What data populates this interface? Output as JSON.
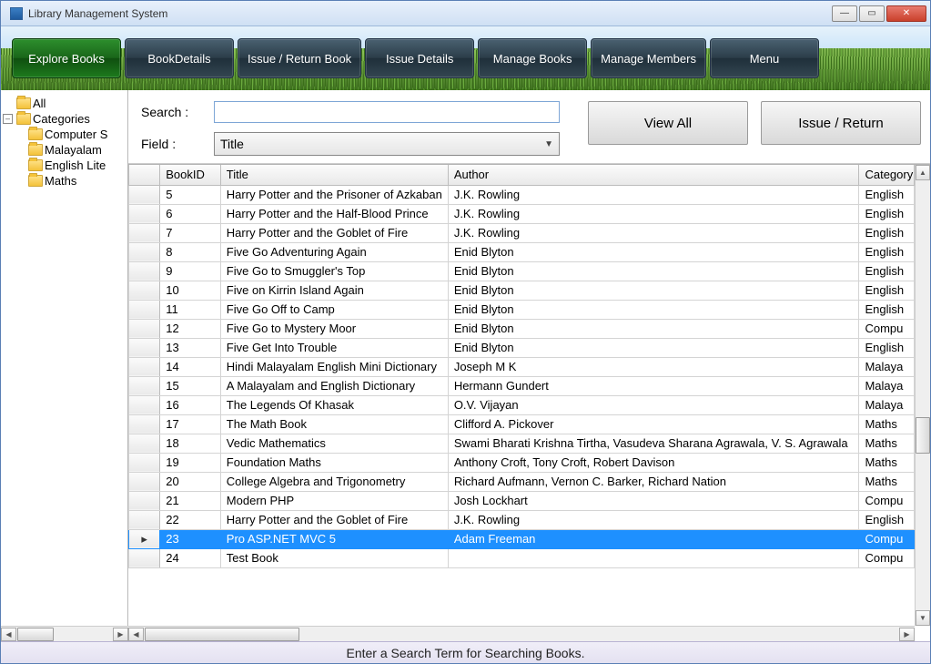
{
  "window": {
    "title": "Library Management System"
  },
  "nav": [
    {
      "label": "Explore Books",
      "active": true
    },
    {
      "label": "BookDetails"
    },
    {
      "label": "Issue / Return Book"
    },
    {
      "label": "Issue Details"
    },
    {
      "label": "Manage Books"
    },
    {
      "label": "Manage Members"
    },
    {
      "label": "Menu"
    }
  ],
  "tree": {
    "all": "All",
    "categories": "Categories",
    "children": [
      "Computer S",
      "Malayalam",
      "English Lite",
      "Maths"
    ]
  },
  "search": {
    "search_label": "Search :",
    "field_label": "Field :",
    "field_value": "Title",
    "view_all": "View All",
    "issue_return": "Issue / Return"
  },
  "grid": {
    "columns": [
      "BookID",
      "Title",
      "Author",
      "Category"
    ],
    "selected_index": 18,
    "rows": [
      {
        "id": "5",
        "title": "Harry Potter and the Prisoner of Azkaban",
        "author": "J.K. Rowling",
        "cat": "English"
      },
      {
        "id": "6",
        "title": "Harry Potter and the Half-Blood Prince",
        "author": "J.K. Rowling",
        "cat": "English"
      },
      {
        "id": "7",
        "title": "Harry Potter and the Goblet of Fire",
        "author": "J.K. Rowling",
        "cat": "English"
      },
      {
        "id": "8",
        "title": "Five Go Adventuring Again",
        "author": "Enid Blyton",
        "cat": "English"
      },
      {
        "id": "9",
        "title": "Five Go to Smuggler's Top",
        "author": "Enid Blyton",
        "cat": "English"
      },
      {
        "id": "10",
        "title": "Five on Kirrin Island Again",
        "author": "Enid Blyton",
        "cat": "English"
      },
      {
        "id": "11",
        "title": "Five Go Off to Camp",
        "author": "Enid Blyton",
        "cat": "English"
      },
      {
        "id": "12",
        "title": "Five Go to Mystery Moor",
        "author": "Enid Blyton",
        "cat": "Compu"
      },
      {
        "id": "13",
        "title": "Five Get Into Trouble",
        "author": "Enid Blyton",
        "cat": "English"
      },
      {
        "id": "14",
        "title": "Hindi Malayalam English Mini Dictionary",
        "author": "Joseph M K",
        "cat": "Malaya"
      },
      {
        "id": "15",
        "title": "A Malayalam and English Dictionary",
        "author": "Hermann Gundert",
        "cat": "Malaya"
      },
      {
        "id": "16",
        "title": "The Legends Of Khasak",
        "author": "O.V. Vijayan",
        "cat": "Malaya"
      },
      {
        "id": "17",
        "title": "The Math Book",
        "author": "Clifford A. Pickover",
        "cat": "Maths"
      },
      {
        "id": "18",
        "title": "Vedic Mathematics",
        "author": "Swami Bharati Krishna Tirtha, Vasudeva Sharana Agrawala, V. S. Agrawala",
        "cat": "Maths"
      },
      {
        "id": "19",
        "title": "Foundation Maths",
        "author": "Anthony Croft, Tony Croft, Robert Davison",
        "cat": "Maths"
      },
      {
        "id": "20",
        "title": "College Algebra and Trigonometry",
        "author": "Richard Aufmann, Vernon C. Barker, Richard Nation",
        "cat": "Maths"
      },
      {
        "id": "21",
        "title": "Modern PHP",
        "author": "Josh Lockhart",
        "cat": "Compu"
      },
      {
        "id": "22",
        "title": "Harry Potter and the Goblet of Fire",
        "author": "J.K. Rowling",
        "cat": "English"
      },
      {
        "id": "23",
        "title": "Pro ASP.NET MVC 5",
        "author": "Adam Freeman",
        "cat": "Compu"
      },
      {
        "id": "24",
        "title": "Test Book",
        "author": "",
        "cat": "Compu"
      }
    ]
  },
  "status": "Enter a Search Term for Searching Books."
}
